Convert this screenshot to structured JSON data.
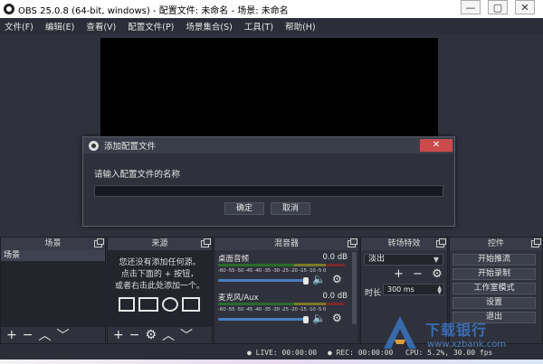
{
  "window": {
    "title": "OBS 25.0.8 (64-bit, windows) - 配置文件: 未命名 - 场景: 未命名",
    "minimize_glyph": "—",
    "maximize_glyph": "▢",
    "close_glyph": "✕"
  },
  "menu": {
    "items": [
      "文件(F)",
      "编辑(E)",
      "查看(V)",
      "配置文件(P)",
      "场景集合(S)",
      "工具(T)",
      "帮助(H)"
    ]
  },
  "dialog": {
    "title": "添加配置文件",
    "close_glyph": "✕",
    "prompt": "请输入配置文件的名称",
    "input_value": "",
    "ok_label": "确定",
    "cancel_label": "取消"
  },
  "scenes": {
    "header": "场景",
    "items": [
      "场景"
    ]
  },
  "sources": {
    "header": "来源",
    "hint_line1": "您还没有添加任何源。",
    "hint_line2": "点击下面的 + 按钮，",
    "hint_line3": "或者右击此处添加一个。"
  },
  "mixer": {
    "header": "混音器",
    "channels": [
      {
        "name": "桌面音频",
        "db": "0.0 dB"
      },
      {
        "name": "麦克风/Aux",
        "db": "0.0 dB"
      }
    ],
    "scale": "-60 -55 -50 -45 -40 -35 -30 -25 -20 -15 -10 -5 0"
  },
  "transitions": {
    "header": "转场特效",
    "selected": "淡出",
    "duration_label": "时长",
    "duration_value": "300 ms"
  },
  "controls": {
    "header": "控件",
    "buttons": [
      "开始推流",
      "开始录制",
      "工作室模式",
      "设置",
      "退出"
    ]
  },
  "status": {
    "live": "LIVE: 00:00:00",
    "rec": "REC: 00:00:00",
    "cpu": "CPU: 5.2%, 30.00 fps"
  },
  "watermark": {
    "cn": "下载银行",
    "en": "www.xzbank.com"
  },
  "colors": {
    "menubar": "#2b2e38",
    "workspace": "#2f323d",
    "preview": "#000000",
    "dialog_close": "#c94b4b",
    "watermark": "#3c78c8"
  }
}
